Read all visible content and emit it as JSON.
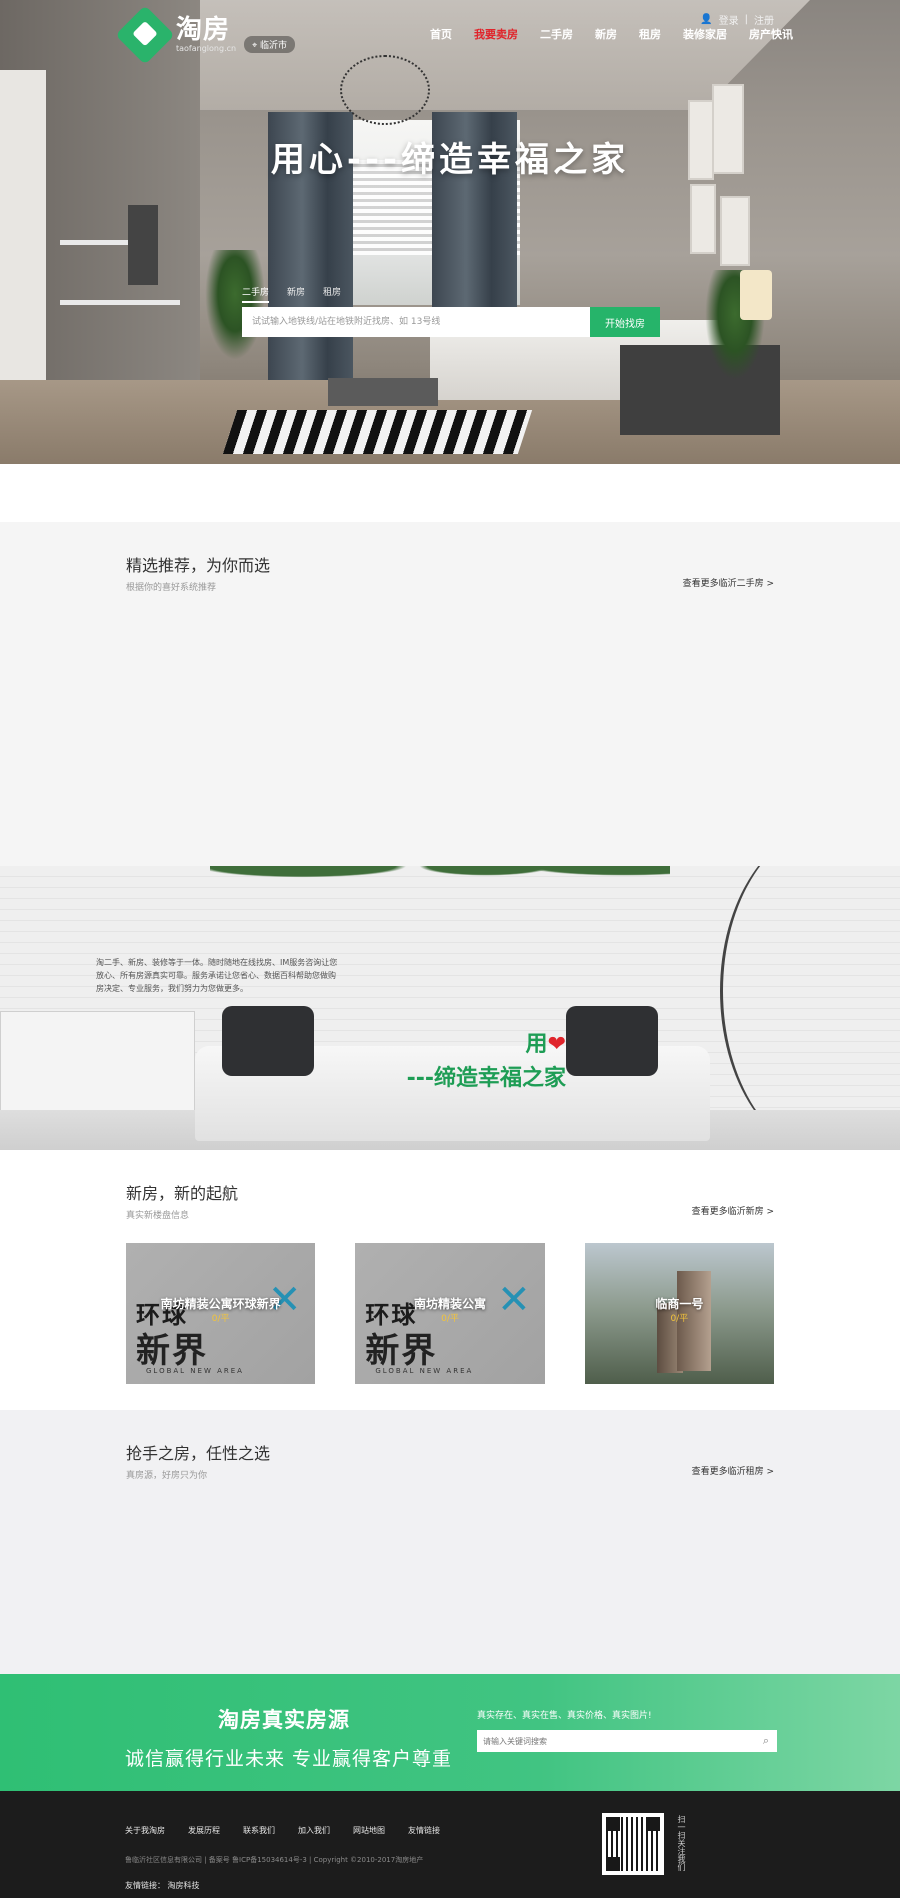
{
  "header": {
    "logo_name": "淘房",
    "logo_domain": "taofanglong.cn",
    "city": "临沂市",
    "nav": [
      {
        "label": "首页",
        "active": false
      },
      {
        "label": "我要卖房",
        "active": true
      },
      {
        "label": "二手房",
        "active": false
      },
      {
        "label": "新房",
        "active": false
      },
      {
        "label": "租房",
        "active": false
      },
      {
        "label": "装修家居",
        "active": false
      },
      {
        "label": "房产快讯",
        "active": false
      }
    ],
    "login": "登录",
    "register": "注册"
  },
  "hero": {
    "slogan": "用心---缔造幸福之家",
    "tabs": [
      "二手房",
      "新房",
      "租房"
    ],
    "search_placeholder": "试试输入地铁线/站在地铁附近找房、如 13号线",
    "search_button": "开始找房"
  },
  "recommend": {
    "title": "精选推荐，为你而选",
    "subtitle": "根据你的喜好系统推荐",
    "more": "查看更多临沂二手房 >"
  },
  "banner2": {
    "text": "淘二手、新房、装修等于一体。随时随地在线找房、IM服务咨询让您放心、所有房源真实可靠。服务承诺让您省心、数据百科帮助您做购房决定、专业服务，我们努力为您做更多。",
    "slogan_word": "用",
    "slogan_line2": "---缔造幸福之家"
  },
  "newhouse": {
    "title": "新房，新的起航",
    "subtitle": "真实新楼盘信息",
    "more": "查看更多临沂新房 >",
    "cards": [
      {
        "name": "南坊精装公寓环球新界",
        "price": "0/平",
        "image_word1": "环球",
        "image_word2": "新界",
        "image_word3": "GLOBAL  NEW AREA"
      },
      {
        "name": "南坊精装公寓",
        "price": "0/平",
        "image_word1": "环球",
        "image_word2": "新界",
        "image_word3": "GLOBAL  NEW AREA"
      },
      {
        "name": "临商一号",
        "price": "0/平"
      }
    ]
  },
  "rent": {
    "title": "抢手之房，任性之选",
    "subtitle": "真房源，好房只为你",
    "more": "查看更多临沂租房 >"
  },
  "greenbar": {
    "title": "淘房真实房源",
    "subtitle": "诚信赢得行业未来 专业赢得客户尊重",
    "tags": "真实存在、真实在售、真实价格、真实图片!",
    "search_placeholder": "请输入关键词搜索"
  },
  "footer": {
    "links": [
      "关于我淘房",
      "发展历程",
      "联系我们",
      "加入我们",
      "网站地图",
      "友情链接"
    ],
    "copyright": "鲁临沂社区信息有限公司 | 备案号 鲁ICP备15034614号-3 | Copyright ©2010-2017淘房地产",
    "friend_label": "友情链接：",
    "friend_link": "淘房科技",
    "qr_caption": "扫一扫关注我们"
  },
  "colors": {
    "brand_green": "#26b46a",
    "nav_active": "#e0242b",
    "footer_bg": "#1c1c1c"
  }
}
